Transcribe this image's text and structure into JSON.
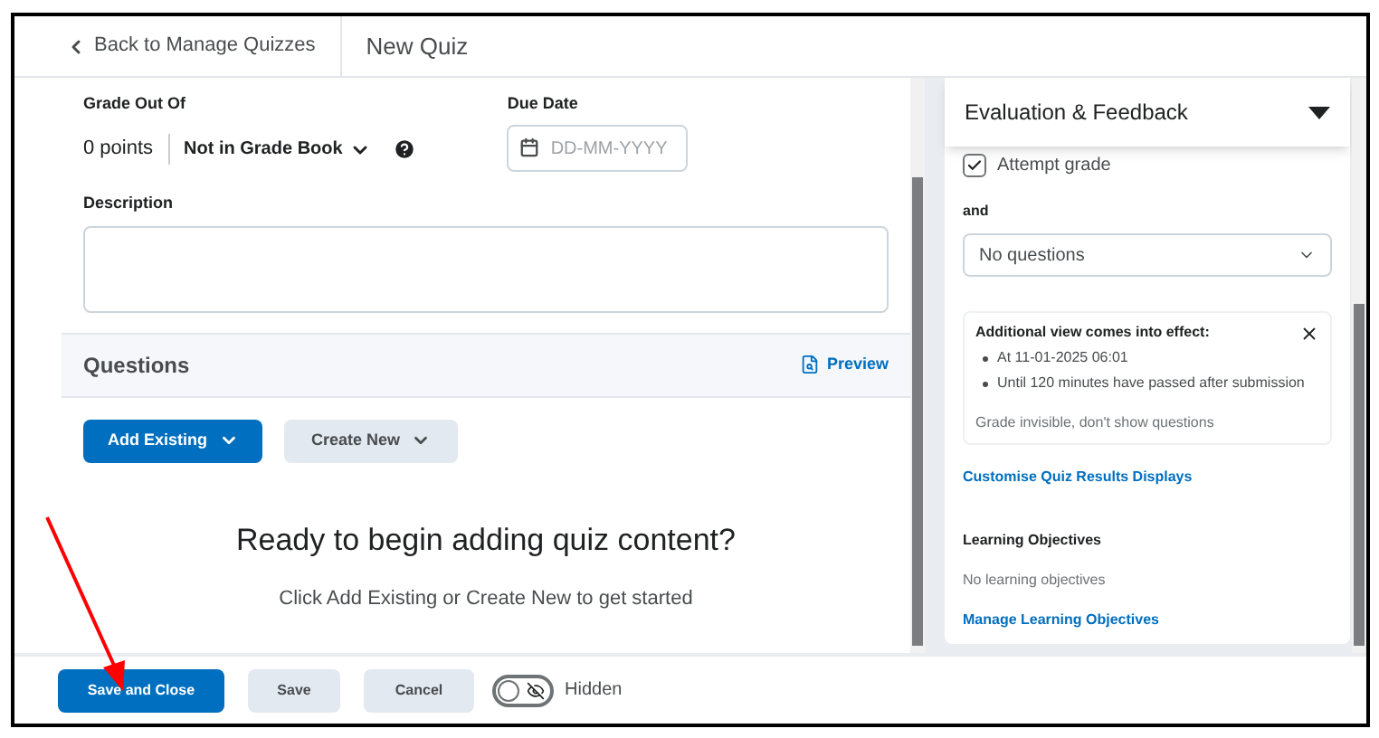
{
  "header": {
    "back_link": "Back to Manage Quizzes",
    "title": "New Quiz"
  },
  "grade": {
    "label": "Grade Out Of",
    "value": "0 points",
    "gradebook": "Not in Grade Book"
  },
  "due_date": {
    "label": "Due Date",
    "placeholder": "DD-MM-YYYY"
  },
  "description": {
    "label": "Description"
  },
  "questions": {
    "title": "Questions",
    "preview": "Preview",
    "add_existing": "Add Existing",
    "create_new": "Create New",
    "empty_title": "Ready to begin adding quiz content?",
    "empty_hint": "Click Add Existing or Create New to get started"
  },
  "evaluation": {
    "title": "Evaluation & Feedback",
    "expanded": true,
    "attempt_grade": {
      "label": "Attempt grade",
      "checked": true
    },
    "and_label": "and",
    "select_value": "No questions",
    "view_card": {
      "title": "Additional view comes into effect:",
      "bullets": [
        "At 11-01-2025 06:01",
        "Until 120 minutes have passed after submission"
      ],
      "note": "Grade invisible, don't show questions"
    },
    "customise_link": "Customise Quiz Results Displays",
    "objectives_label": "Learning Objectives",
    "objectives_text": "No learning objectives",
    "manage_link": "Manage Learning Objectives"
  },
  "footer": {
    "save_close": "Save and Close",
    "save": "Save",
    "cancel": "Cancel",
    "visibility": {
      "label": "Hidden",
      "on": false
    }
  }
}
